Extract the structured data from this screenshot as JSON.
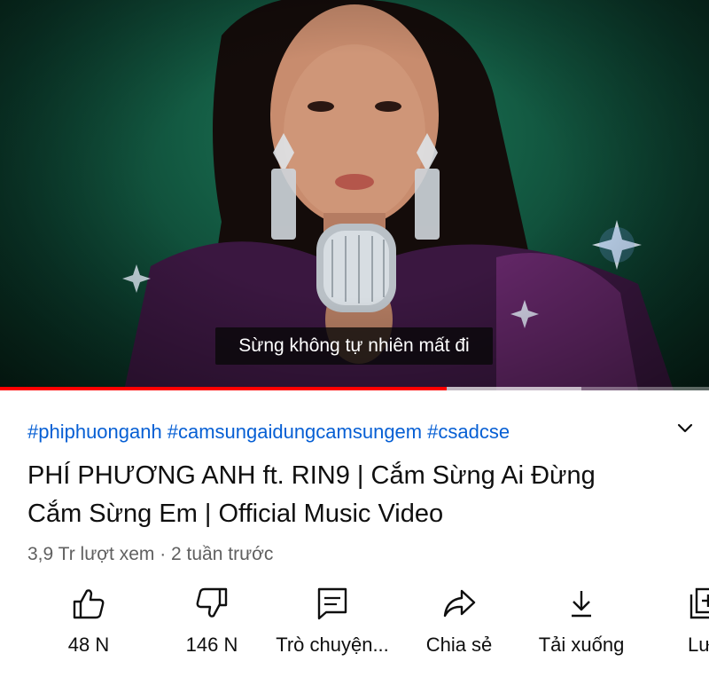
{
  "player": {
    "caption": "Sừng không tự nhiên mất đi",
    "progress_played": 0.63,
    "progress_buffered": 0.82
  },
  "info": {
    "hashtags": [
      "#phiphuonganh",
      "#camsungaidungcamsungem",
      "#csadcse"
    ],
    "title": "PHÍ PHƯƠNG ANH ft. RIN9 | Cắm Sừng Ai Đừng Cắm Sừng Em | Official Music Video",
    "meta": "3,9 Tr lượt xem · 2 tuần trước",
    "expand_icon": "chevron-down-icon"
  },
  "actions": [
    {
      "label": "48 N",
      "icon": "like-icon"
    },
    {
      "label": "146 N",
      "icon": "dislike-icon"
    },
    {
      "label": "Trò chuyện...",
      "icon": "live-chat-icon"
    },
    {
      "label": "Chia sẻ",
      "icon": "share-icon"
    },
    {
      "label": "Tải xuống",
      "icon": "download-icon"
    },
    {
      "label": "Lưu",
      "icon": "save-icon"
    }
  ],
  "colors": {
    "link": "#065fd4",
    "progress": "#ff0000",
    "text": "#0f0f0f",
    "secondary": "#606060"
  }
}
